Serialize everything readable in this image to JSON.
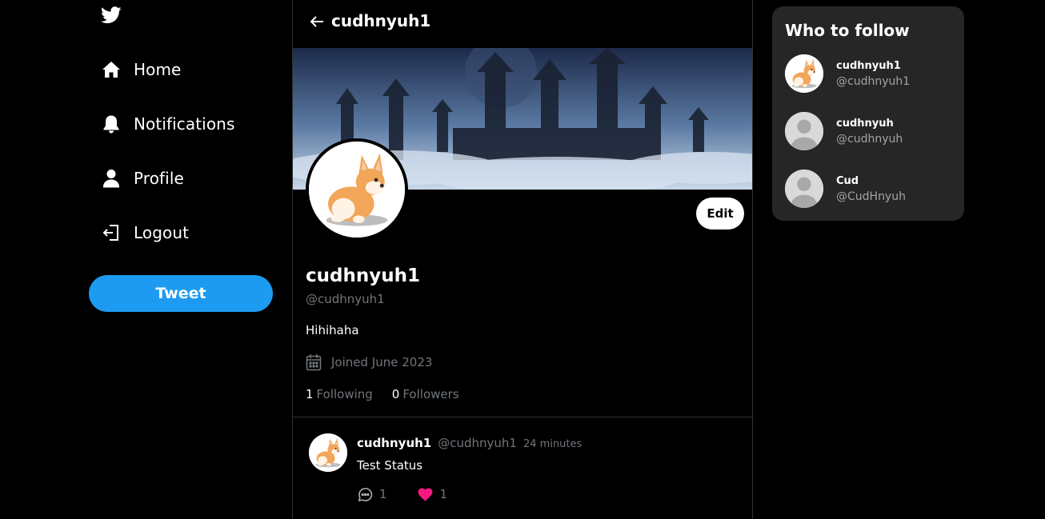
{
  "nav": {
    "logo_icon": "twitter-bird-icon",
    "items": [
      {
        "label": "Home",
        "icon": "home-icon"
      },
      {
        "label": "Notifications",
        "icon": "bell-icon"
      },
      {
        "label": "Profile",
        "icon": "user-icon"
      },
      {
        "label": "Logout",
        "icon": "logout-icon"
      }
    ],
    "tweet_label": "Tweet"
  },
  "header": {
    "title": "cudhnyuh1",
    "back_icon": "arrow-left-icon"
  },
  "profile": {
    "edit_label": "Edit",
    "name": "cudhnyuh1",
    "handle": "@cudhnyuh1",
    "bio": "Hihihaha",
    "joined": "Joined June 2023",
    "following_count": "1",
    "following_label": "Following",
    "followers_count": "0",
    "followers_label": "Followers"
  },
  "tweet": {
    "name": "cudhnyuh1",
    "handle": "@cudhnyuh1",
    "time": "24 minutes",
    "text": "Test Status",
    "comments": "1",
    "likes": "1"
  },
  "who_to_follow": {
    "title": "Who to follow",
    "users": [
      {
        "name": "cudhnyuh1",
        "handle": "@cudhnyuh1"
      },
      {
        "name": "cudhnyuh",
        "handle": "@cudhnyuh"
      },
      {
        "name": "Cud",
        "handle": "@CudHnyuh"
      }
    ]
  },
  "colors": {
    "accent": "#1d9bf0",
    "like": "#f91880",
    "muted": "#71767b",
    "card": "#262626"
  }
}
